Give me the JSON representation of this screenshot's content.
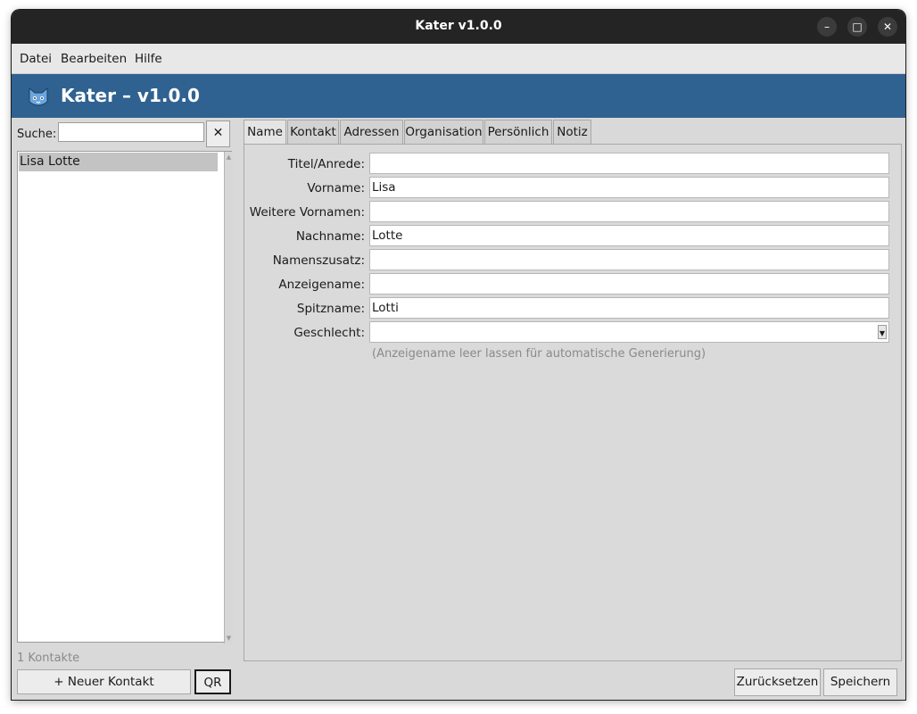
{
  "window": {
    "title": "Kater v1.0.0"
  },
  "window_controls": {
    "minimize": "–",
    "maximize": "□",
    "close": "✕"
  },
  "menu": [
    "Datei",
    "Bearbeiten",
    "Hilfe"
  ],
  "header": {
    "title": "Kater  –  v1.0.0",
    "icon": "cat-logo-icon"
  },
  "sidebar": {
    "search_label": "Suche:",
    "search_value": "",
    "clear_label": "✕",
    "contacts": [
      "Lisa Lotte"
    ],
    "count": "1 Kontakte",
    "new_contact": "+ Neuer Kontakt",
    "qr": "QR"
  },
  "tabs": [
    "Name",
    "Kontakt",
    "Adressen",
    "Organisation",
    "Persönlich",
    "Notiz"
  ],
  "active_tab": "Name",
  "form": {
    "fields": [
      {
        "label": "Titel/Anrede:",
        "value": ""
      },
      {
        "label": "Vorname:",
        "value": "Lisa"
      },
      {
        "label": "Weitere Vornamen:",
        "value": ""
      },
      {
        "label": "Nachname:",
        "value": "Lotte"
      },
      {
        "label": "Namenszusatz:",
        "value": ""
      },
      {
        "label": "Anzeigename:",
        "value": ""
      },
      {
        "label": "Spitzname:",
        "value": "Lotti"
      },
      {
        "label": "Geschlecht:",
        "value": ""
      }
    ],
    "hint": "(Anzeigename leer lassen für automatische Generierung)"
  },
  "footer": {
    "reset": "Zurücksetzen",
    "save": "Speichern"
  },
  "colors": {
    "header_bg": "#2f6290",
    "titlebar_bg": "#242424",
    "window_bg": "#d9d9d9"
  }
}
